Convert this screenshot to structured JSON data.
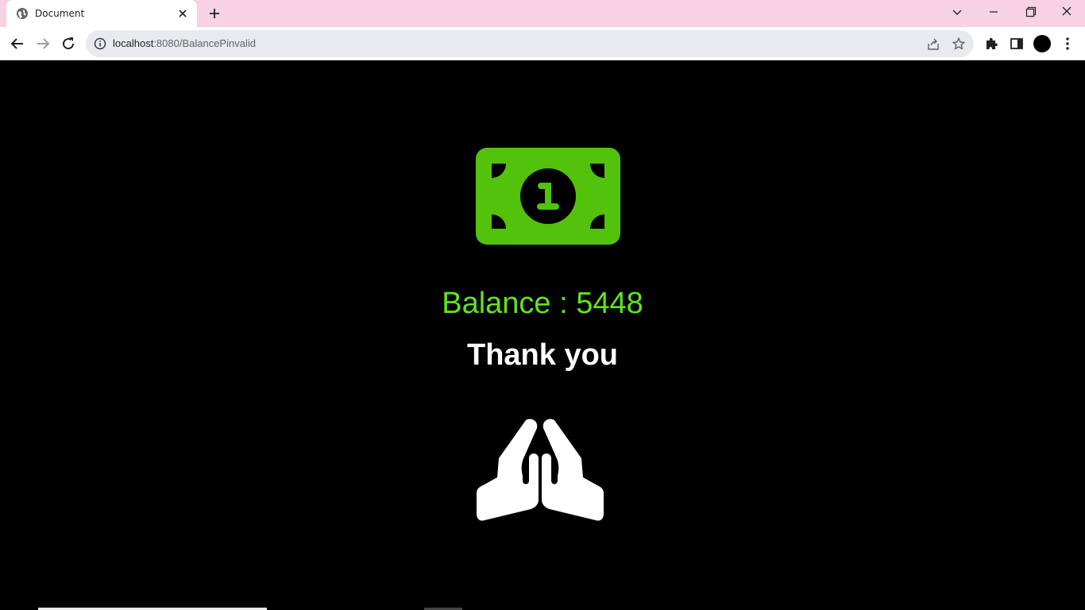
{
  "browser": {
    "tab_title": "Document",
    "url_host": "localhost",
    "url_path": ":8080/BalancePinvalid"
  },
  "page": {
    "balance_text": "Balance : 5448",
    "thanks_text": "Thank you"
  },
  "colors": {
    "tab_strip": "#f6d2e2",
    "money_green": "#53c20a",
    "balance_green": "#5fe421",
    "background": "#000000"
  },
  "icons": {
    "money": "money-bill-icon",
    "hands": "praying-hands-icon"
  }
}
